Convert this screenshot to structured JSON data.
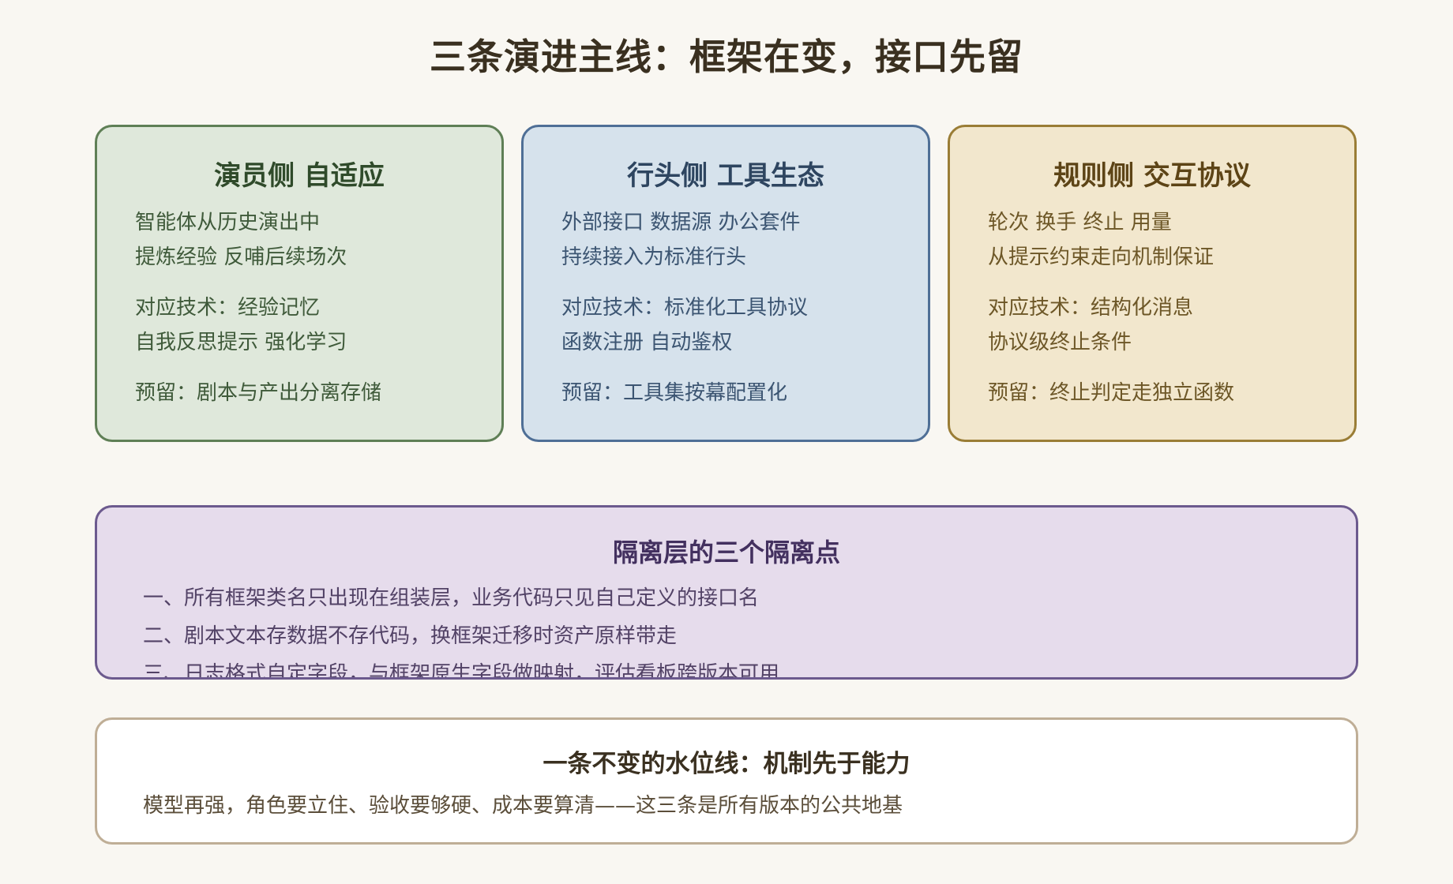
{
  "title": "三条演进主线：框架在变，接口先留",
  "cards": [
    {
      "title": "演员侧 自适应",
      "lines": [
        "智能体从历史演出中",
        "提炼经验 反哺后续场次",
        "对应技术：经验记忆",
        "自我反思提示 强化学习",
        "预留：剧本与产出分离存储"
      ],
      "accent": "#5f7f56",
      "background": "#dfe8db"
    },
    {
      "title": "行头侧 工具生态",
      "lines": [
        "外部接口 数据源 办公套件",
        "持续接入为标准行头",
        "对应技术：标准化工具协议",
        "函数注册 自动鉴权",
        "预留：工具集按幕配置化"
      ],
      "accent": "#4f6f96",
      "background": "#d6e2ec"
    },
    {
      "title": "规则侧 交互协议",
      "lines": [
        "轮次 换手 终止 用量",
        "从提示约束走向机制保证",
        "对应技术：结构化消息",
        "协议级终止条件",
        "预留：终止判定走独立函数"
      ],
      "accent": "#9a7d36",
      "background": "#f2e7cd"
    }
  ],
  "isolation": {
    "title": "隔离层的三个隔离点",
    "items": [
      "一、所有框架类名只出现在组装层，业务代码只见自己定义的接口名",
      "二、剧本文本存数据不存代码，换框架迁移时资产原样带走",
      "三、日志格式自定字段，与框架原生字段做映射，评估看板跨版本可用"
    ],
    "accent": "#6c5a8e",
    "background": "#e6dcec"
  },
  "waterline": {
    "title": "一条不变的水位线：机制先于能力",
    "text": "模型再强，角色要立住、验收要够硬、成本要算清——这三条是所有版本的公共地基"
  }
}
